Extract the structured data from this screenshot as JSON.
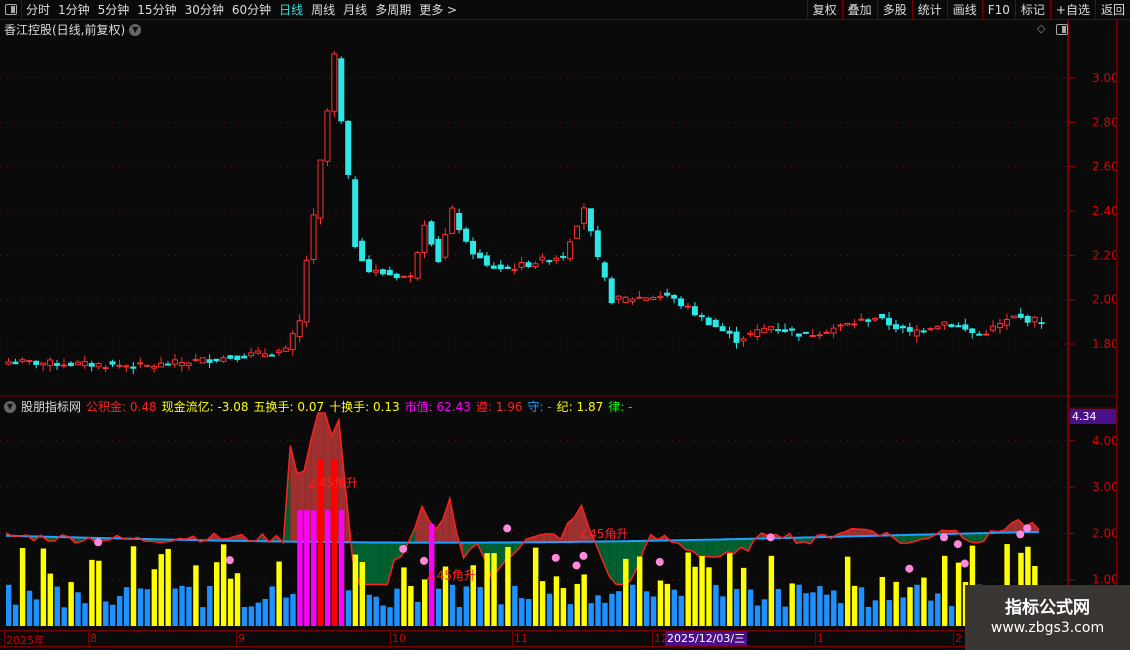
{
  "toolbar": {
    "periods": [
      "分时",
      "1分钟",
      "5分钟",
      "15分钟",
      "30分钟",
      "60分钟",
      "日线",
      "周线",
      "月线",
      "多周期",
      "更多 >"
    ],
    "active_period": "日线",
    "right_buttons": [
      "复权",
      "叠加",
      "多股",
      "统计",
      "画线",
      "F10",
      "标记",
      "+自选",
      "返回"
    ]
  },
  "main_chart": {
    "title": "香江控股(日线,前复权)",
    "price_ticks": [
      "3.00",
      "2.80",
      "2.60",
      "2.40",
      "2.20",
      "2.00",
      "1.80"
    ],
    "up_color": "#ff3030",
    "down_color": "#2ee6e6",
    "close_keypoints": [
      [
        0,
        1.72
      ],
      [
        20,
        1.7
      ],
      [
        40,
        1.77
      ],
      [
        42,
        1.9
      ],
      [
        43,
        2.18
      ],
      [
        44,
        2.37
      ],
      [
        45,
        2.62
      ],
      [
        46,
        2.85
      ],
      [
        47,
        3.1
      ],
      [
        48,
        2.8
      ],
      [
        49,
        2.55
      ],
      [
        50,
        2.25
      ],
      [
        52,
        2.13
      ],
      [
        58,
        2.1
      ],
      [
        60,
        2.35
      ],
      [
        62,
        2.18
      ],
      [
        64,
        2.4
      ],
      [
        66,
        2.25
      ],
      [
        69,
        2.15
      ],
      [
        72,
        2.14
      ],
      [
        80,
        2.2
      ],
      [
        83,
        2.42
      ],
      [
        85,
        2.18
      ],
      [
        87,
        2.0
      ],
      [
        95,
        2.02
      ],
      [
        100,
        1.92
      ],
      [
        105,
        1.82
      ],
      [
        110,
        1.88
      ],
      [
        115,
        1.84
      ],
      [
        125,
        1.92
      ],
      [
        130,
        1.85
      ],
      [
        135,
        1.9
      ],
      [
        140,
        1.84
      ],
      [
        145,
        1.92
      ],
      [
        150,
        1.9
      ]
    ]
  },
  "indicator": {
    "name": "股朋指标网",
    "fields": [
      {
        "label": "公积金:",
        "value": "0.48",
        "color": "#ff2020"
      },
      {
        "label": "现金流亿:",
        "value": "-3.08",
        "color": "#ffff00"
      },
      {
        "label": "五换手:",
        "value": "0.07",
        "color": "#ffff00"
      },
      {
        "label": "十换手:",
        "value": "0.13",
        "color": "#ffff00"
      },
      {
        "label": "市值:",
        "value": "62.43",
        "color": "#ff00ff"
      },
      {
        "label": "遵:",
        "value": "1.96",
        "color": "#ff2020"
      },
      {
        "label": "守:",
        "value": "-",
        "color": "#1ea0ff"
      },
      {
        "label": "纪:",
        "value": "1.87",
        "color": "#ffff00"
      },
      {
        "label": "律:",
        "value": "-",
        "color": "#00ff00"
      }
    ],
    "current_value": "4.34",
    "ticks": [
      "4.00",
      "3.00",
      "2.00",
      "1.00"
    ],
    "annotations": [
      {
        "text": "∠45角升",
        "bar": 45,
        "value": 3.0
      },
      {
        "text": "∠45角升",
        "bar": 62,
        "value": 1.0
      },
      {
        "text": "∠45角升",
        "bar": 84,
        "value": 1.9
      }
    ],
    "bar_colors": {
      "blue": "#1e90ff",
      "yellow": "#ffff00",
      "magenta": "#ff00ff",
      "red": "#ff0000"
    }
  },
  "time_axis": {
    "labels": [
      "2025年",
      "8",
      "9",
      "10",
      "11",
      "12",
      "1",
      "2"
    ],
    "selected_date": "2025/12/03/三"
  },
  "watermark": {
    "title": "指标公式网",
    "url": "www.zbgs3.com"
  }
}
